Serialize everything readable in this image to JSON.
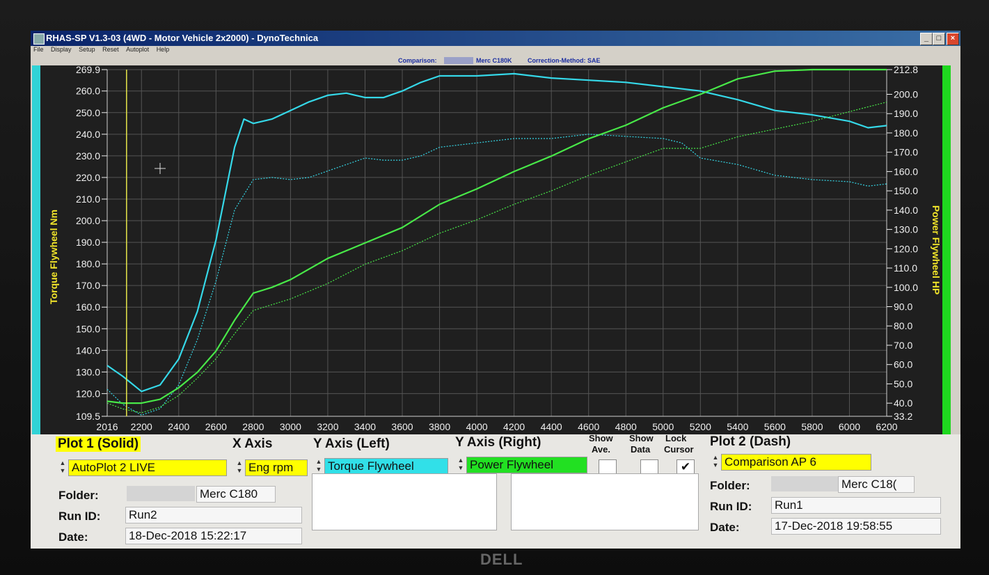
{
  "window": {
    "title": "RHAS-SP V1.3-03  (4WD - Motor Vehicle 2x2000) - DynoTechnica",
    "menu": [
      "File",
      "Display",
      "Setup",
      "Reset",
      "Autoplot",
      "Help"
    ],
    "min_label": "_",
    "max_label": "□",
    "close_label": "×"
  },
  "infobar": {
    "comparison_label": "Comparison:",
    "comparison_value": "Merc C180K",
    "correction_label": "Correction-Method: SAE"
  },
  "chart_data": {
    "type": "line",
    "xlabel": "",
    "ylabel_left": "Torque Flywheel Nm",
    "ylabel_right": "Power Flywheel HP",
    "xlim": [
      2016,
      6200
    ],
    "ylim_left": [
      109.5,
      269.9
    ],
    "ylim_right": [
      33.2,
      212.8
    ],
    "x_ticks": [
      "2016",
      "2200",
      "2400",
      "2600",
      "2800",
      "3000",
      "3200",
      "3400",
      "3600",
      "3800",
      "4000",
      "4200",
      "4400",
      "4600",
      "4800",
      "5000",
      "5200",
      "5400",
      "5600",
      "5800",
      "6000",
      "6200"
    ],
    "left_ticks": [
      "269.9",
      "260.0",
      "250.0",
      "240.0",
      "230.0",
      "220.0",
      "210.0",
      "200.0",
      "190.0",
      "180.0",
      "170.0",
      "160.0",
      "150.0",
      "140.0",
      "130.0",
      "120.0",
      "109.5"
    ],
    "right_ticks": [
      "212.8",
      "200.0",
      "190.0",
      "180.0",
      "170.0",
      "160.0",
      "150.0",
      "140.0",
      "130.0",
      "120.0",
      "110.0",
      "100.0",
      "90.0",
      "80.0",
      "70.0",
      "60.0",
      "50.0",
      "40.0",
      "33.2"
    ],
    "grid": true,
    "cursor_x": 2120,
    "series": [
      {
        "color": "#35d8e8",
        "style": "solid",
        "axis": "left",
        "x": [
          2016,
          2100,
          2200,
          2300,
          2400,
          2500,
          2600,
          2700,
          2750,
          2800,
          2900,
          3000,
          3100,
          3200,
          3300,
          3400,
          3500,
          3600,
          3700,
          3800,
          3900,
          4000,
          4200,
          4400,
          4600,
          4800,
          5000,
          5200,
          5400,
          5600,
          5800,
          6000,
          6100,
          6200
        ],
        "y": [
          133,
          128,
          121,
          124,
          136,
          158,
          191,
          234,
          247,
          245,
          247,
          251,
          255,
          258,
          259,
          257,
          257,
          260,
          264,
          267,
          267,
          267,
          268,
          266,
          265,
          264,
          262,
          260,
          256,
          251,
          249,
          246,
          243,
          244
        ]
      },
      {
        "color": "#35d8e8",
        "style": "dotted",
        "axis": "left",
        "x": [
          2016,
          2100,
          2200,
          2300,
          2400,
          2500,
          2600,
          2700,
          2800,
          2900,
          3000,
          3100,
          3200,
          3300,
          3400,
          3500,
          3600,
          3700,
          3800,
          3900,
          4000,
          4200,
          4400,
          4600,
          4800,
          5000,
          5100,
          5200,
          5400,
          5600,
          5800,
          6000,
          6100,
          6200
        ],
        "y": [
          122,
          115,
          110,
          113,
          124,
          145,
          172,
          205,
          219,
          220,
          219,
          220,
          223,
          226,
          229,
          228,
          228,
          230,
          234,
          235,
          236,
          238,
          238,
          240,
          239,
          238,
          236,
          229,
          226,
          221,
          219,
          218,
          216,
          217
        ]
      },
      {
        "color": "#48e848",
        "style": "solid",
        "axis": "right",
        "x": [
          2016,
          2100,
          2200,
          2300,
          2400,
          2500,
          2600,
          2700,
          2800,
          2900,
          3000,
          3200,
          3400,
          3600,
          3800,
          4000,
          4200,
          4400,
          4600,
          4800,
          5000,
          5200,
          5400,
          5600,
          5800,
          6000,
          6200
        ],
        "y": [
          41,
          40,
          40,
          42,
          48,
          56,
          67,
          83,
          97,
          100,
          104,
          115,
          123,
          131,
          143,
          151,
          160,
          168,
          177,
          184,
          193,
          200,
          208,
          212,
          213,
          213,
          213
        ]
      },
      {
        "color": "#48e848",
        "style": "dotted",
        "axis": "right",
        "x": [
          2016,
          2100,
          2200,
          2300,
          2400,
          2500,
          2600,
          2700,
          2800,
          2900,
          3000,
          3200,
          3400,
          3600,
          3800,
          4000,
          4200,
          4400,
          4600,
          4800,
          5000,
          5200,
          5400,
          5600,
          5800,
          6000,
          6200
        ],
        "y": [
          40,
          37,
          35,
          38,
          44,
          53,
          63,
          76,
          88,
          91,
          94,
          102,
          112,
          119,
          128,
          135,
          143,
          150,
          158,
          165,
          172,
          172,
          178,
          182,
          186,
          191,
          196
        ]
      }
    ]
  },
  "panel": {
    "plot1_label": "Plot 1 (Solid)",
    "plot1_value": "AutoPlot 2 LIVE",
    "x_axis_label": "X Axis",
    "x_axis_value": "Eng rpm",
    "y_left_label": "Y Axis (Left)",
    "y_left_value": "Torque Flywheel",
    "y_right_label": "Y Axis (Right)",
    "y_right_value": "Power Flywheel",
    "show_ave_label_1": "Show",
    "show_ave_label_2": "Ave.",
    "show_data_label_1": "Show",
    "show_data_label_2": "Data",
    "lock_cursor_label_1": "Lock",
    "lock_cursor_label_2": "Cursor",
    "lock_cursor_check": "✔",
    "plot2_label": "Plot 2 (Dash)",
    "plot2_value": "Comparison AP 6",
    "folder_label": "Folder:",
    "left_folder": "Merc C180",
    "runid_label": "Run ID:",
    "left_runid": "Run2",
    "date_label": "Date:",
    "left_date": "18-Dec-2018  15:22:17",
    "right_folder": "Merc C18(",
    "right_runid": "Run1",
    "right_date": "17-Dec-2018  19:58:55"
  },
  "monitor_logo": "DELL"
}
